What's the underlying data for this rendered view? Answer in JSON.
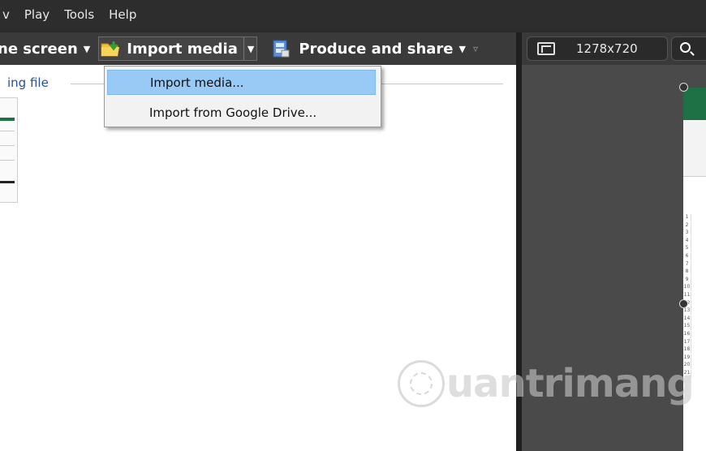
{
  "menubar": {
    "items": [
      "v",
      "Play",
      "Tools",
      "Help"
    ]
  },
  "toolbar": {
    "record_label": "ne screen",
    "import_label": "Import media",
    "produce_label": "Produce and share"
  },
  "left_panel": {
    "group_label": "ing file"
  },
  "dropdown": {
    "items": [
      "Import media...",
      "Import from Google Drive..."
    ],
    "highlight_color": "#99c9f5"
  },
  "right_toolbar": {
    "size": "1278x720"
  },
  "preview": {
    "rows": [
      "1",
      "2",
      "3",
      "4",
      "5",
      "6",
      "7",
      "8",
      "9",
      "10",
      "11",
      "12",
      "13",
      "14",
      "15",
      "16",
      "17",
      "18",
      "19",
      "20",
      "21"
    ]
  },
  "watermark": {
    "text": "uantrimang"
  }
}
